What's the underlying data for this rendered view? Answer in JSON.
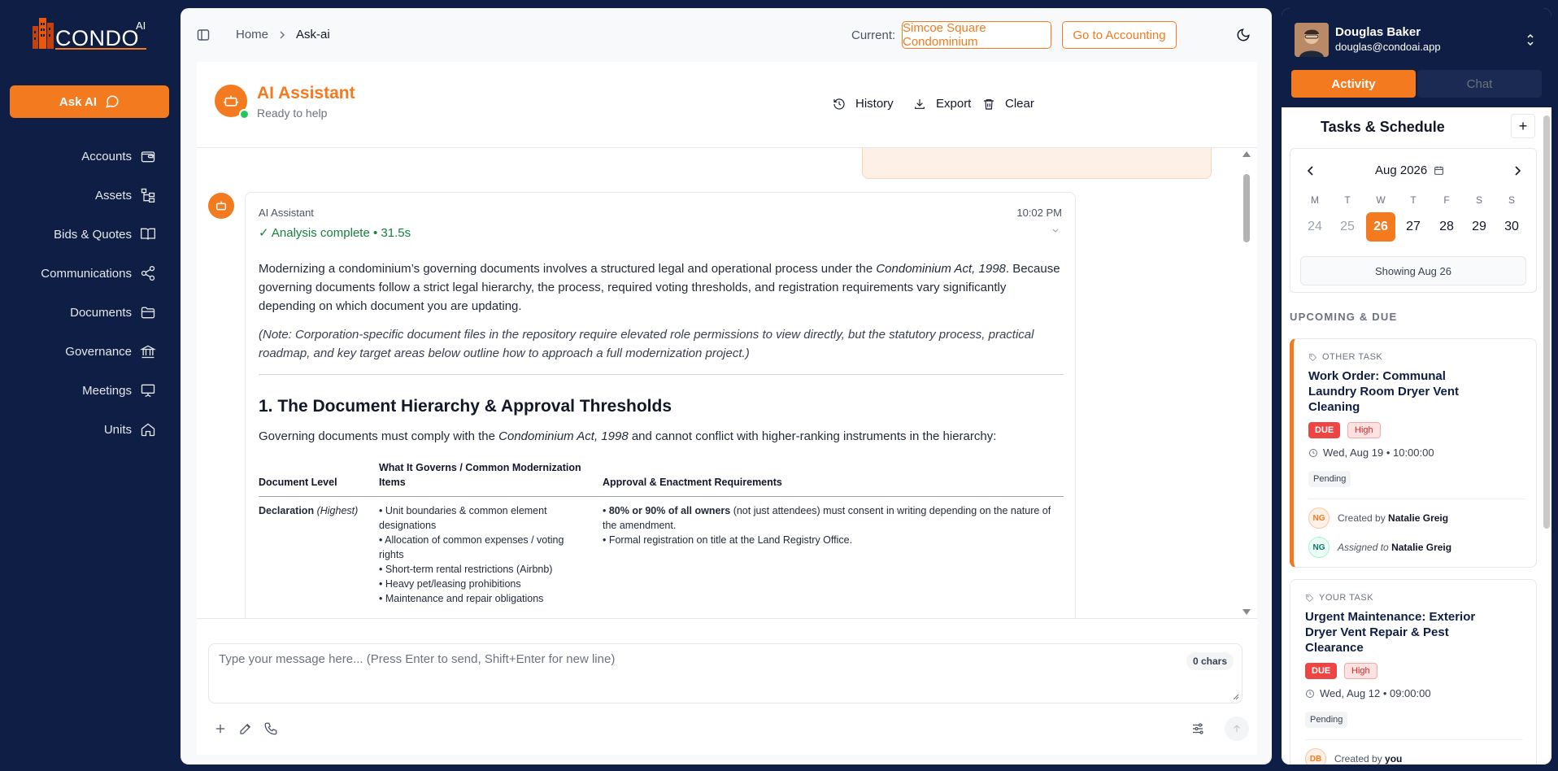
{
  "brand": {
    "name": "CONDO",
    "suffix": "AI",
    "accent": "#f47a1f",
    "navy": "#0f1e44"
  },
  "sidebar": {
    "ask_label": "Ask AI",
    "items": [
      {
        "label": "Accounts",
        "icon": "wallet-icon"
      },
      {
        "label": "Assets",
        "icon": "hierarchy-icon"
      },
      {
        "label": "Bids & Quotes",
        "icon": "book-open-icon"
      },
      {
        "label": "Communications",
        "icon": "share-icon"
      },
      {
        "label": "Documents",
        "icon": "folder-icon"
      },
      {
        "label": "Governance",
        "icon": "bank-icon"
      },
      {
        "label": "Meetings",
        "icon": "presentation-icon"
      },
      {
        "label": "Units",
        "icon": "home-icon"
      }
    ]
  },
  "header": {
    "breadcrumb": [
      "Home",
      "Ask-ai"
    ],
    "current_label": "Current:",
    "current_property": "Simcoe Square Condominium",
    "accounting_button": "Go to Accounting"
  },
  "assistant": {
    "title": "AI Assistant",
    "status": "Ready to help",
    "actions": {
      "history": "History",
      "export": "Export",
      "clear": "Clear"
    }
  },
  "message": {
    "sender": "AI Assistant",
    "time": "10:02 PM",
    "status": "✓ Analysis complete • 31.5s",
    "intro_before": "Modernizing a condominium’s governing documents involves a structured legal and operational process under the ",
    "intro_act": "Condominium Act, 1998",
    "intro_after": ". Because governing documents follow a strict legal hierarchy, the process, required voting thresholds, and registration requirements vary significantly depending on which document you are updating.",
    "note": "(Note: Corporation-specific document files in the repository require elevated role permissions to view directly, but the statutory process, practical roadmap, and key target areas below outline how to approach a full modernization project.)",
    "section_title": "1. The Document Hierarchy & Approval Thresholds",
    "section_before": "Governing documents must comply with the ",
    "section_act": "Condominium Act, 1998",
    "section_after": " and cannot conflict with higher-ranking instruments in the hierarchy:",
    "table": {
      "headers": [
        "Document Level",
        "What It Governs / Common Modernization Items",
        "Approval & Enactment Requirements"
      ],
      "row1": {
        "level": "Declaration",
        "level_note": "(Highest)",
        "governs": [
          "• Unit boundaries & common element designations",
          "• Allocation of common expenses / voting rights",
          "• Short-term rental restrictions (Airbnb)",
          "• Heavy pet/leasing prohibitions",
          "• Maintenance and repair obligations"
        ],
        "req_bold": "80% or 90% of all owners",
        "req_rest": " (not just attendees) must consent in writing depending on the nature of the amendment.",
        "req2": "• Formal registration on title at the Land Registry Office."
      }
    }
  },
  "composer": {
    "placeholder": "Type your message here... (Press Enter to send, Shift+Enter for new line)",
    "chars": "0 chars"
  },
  "user": {
    "name": "Douglas Baker",
    "email": "douglas@condoai.app"
  },
  "right_tabs": {
    "activity": "Activity",
    "chat": "Chat"
  },
  "tasks": {
    "title": "Tasks & Schedule",
    "add": "+",
    "month": "Aug 2026",
    "weekdays": [
      "M",
      "T",
      "W",
      "T",
      "F",
      "S",
      "S"
    ],
    "days": [
      "24",
      "25",
      "26",
      "27",
      "28",
      "29",
      "30"
    ],
    "selected_day": "26",
    "showing": "Showing Aug 26",
    "upcoming_label": "UPCOMING & DUE",
    "items": [
      {
        "tag": "OTHER TASK",
        "title": "Work Order: Communal Laundry Room Dryer Vent Cleaning",
        "due": "DUE",
        "priority": "High",
        "date": "Wed, Aug 19 • 10:00:00",
        "status": "Pending",
        "created_label": "Created by",
        "created_by": "Natalie Greig",
        "created_initials": "NG",
        "assigned_label": "Assigned to",
        "assigned_to": "Natalie Greig",
        "assigned_initials": "NG"
      },
      {
        "tag": "YOUR TASK",
        "title": "Urgent Maintenance: Exterior Dryer Vent Repair & Pest Clearance",
        "due": "DUE",
        "priority": "High",
        "date": "Wed, Aug 12 • 09:00:00",
        "status": "Pending",
        "created_label": "Created by",
        "created_by": "you",
        "created_initials": "DB"
      }
    ]
  }
}
